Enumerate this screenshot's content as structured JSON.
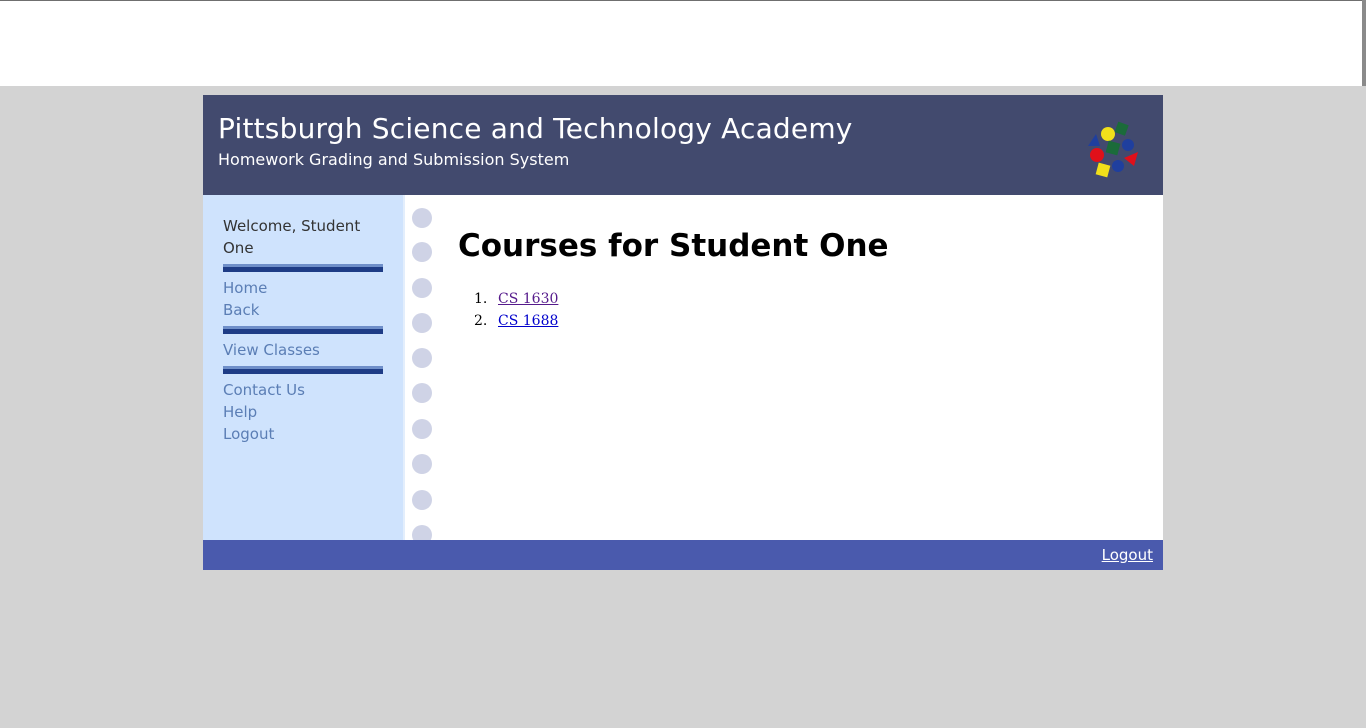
{
  "header": {
    "title": "Pittsburgh Science and Technology Academy",
    "subtitle": "Homework Grading and Submission System",
    "logo_icon": "colored-shapes-logo"
  },
  "sidebar": {
    "welcome": "Welcome, Student One",
    "group1": [
      {
        "label": "Home"
      },
      {
        "label": "Back"
      }
    ],
    "group2": [
      {
        "label": "View Classes"
      }
    ],
    "group3": [
      {
        "label": "Contact Us"
      },
      {
        "label": "Help"
      },
      {
        "label": "Logout"
      }
    ]
  },
  "main": {
    "title": "Courses for Student One",
    "courses": [
      {
        "number": "1.",
        "label": "CS 1630"
      },
      {
        "number": "2.",
        "label": "CS 1688"
      }
    ]
  },
  "footer": {
    "logout_label": "Logout"
  },
  "colors": {
    "header_bg": "#424a6e",
    "sidebar_bg": "#cfe3fd",
    "footer_bg": "#4a5aad",
    "page_bg": "#d3d3d3",
    "nav_link": "#5b7eb5"
  }
}
